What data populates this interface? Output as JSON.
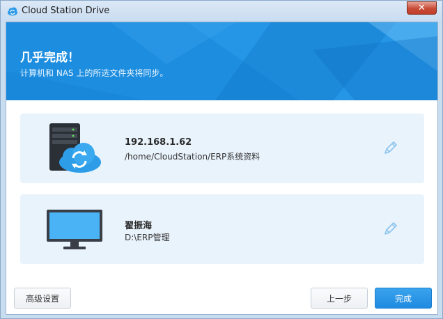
{
  "window": {
    "title": "Cloud Station Drive",
    "close_label": "✕"
  },
  "banner": {
    "title": "几乎完成！",
    "subtitle": "计算机和 NAS 上的所选文件夹将同步。"
  },
  "sync_pair": [
    {
      "name": "192.168.1.62",
      "path": "/home/CloudStation/ERP系统资料",
      "icon": "nas-sync-icon"
    },
    {
      "name": "翟振海",
      "path": "D:\\ERP管理",
      "icon": "computer-monitor-icon"
    }
  ],
  "buttons": {
    "advanced": "高级设置",
    "prev": "上一步",
    "finish": "完成"
  },
  "colors": {
    "accent": "#1f8fe0",
    "card_bg": "#e9f3fc"
  }
}
